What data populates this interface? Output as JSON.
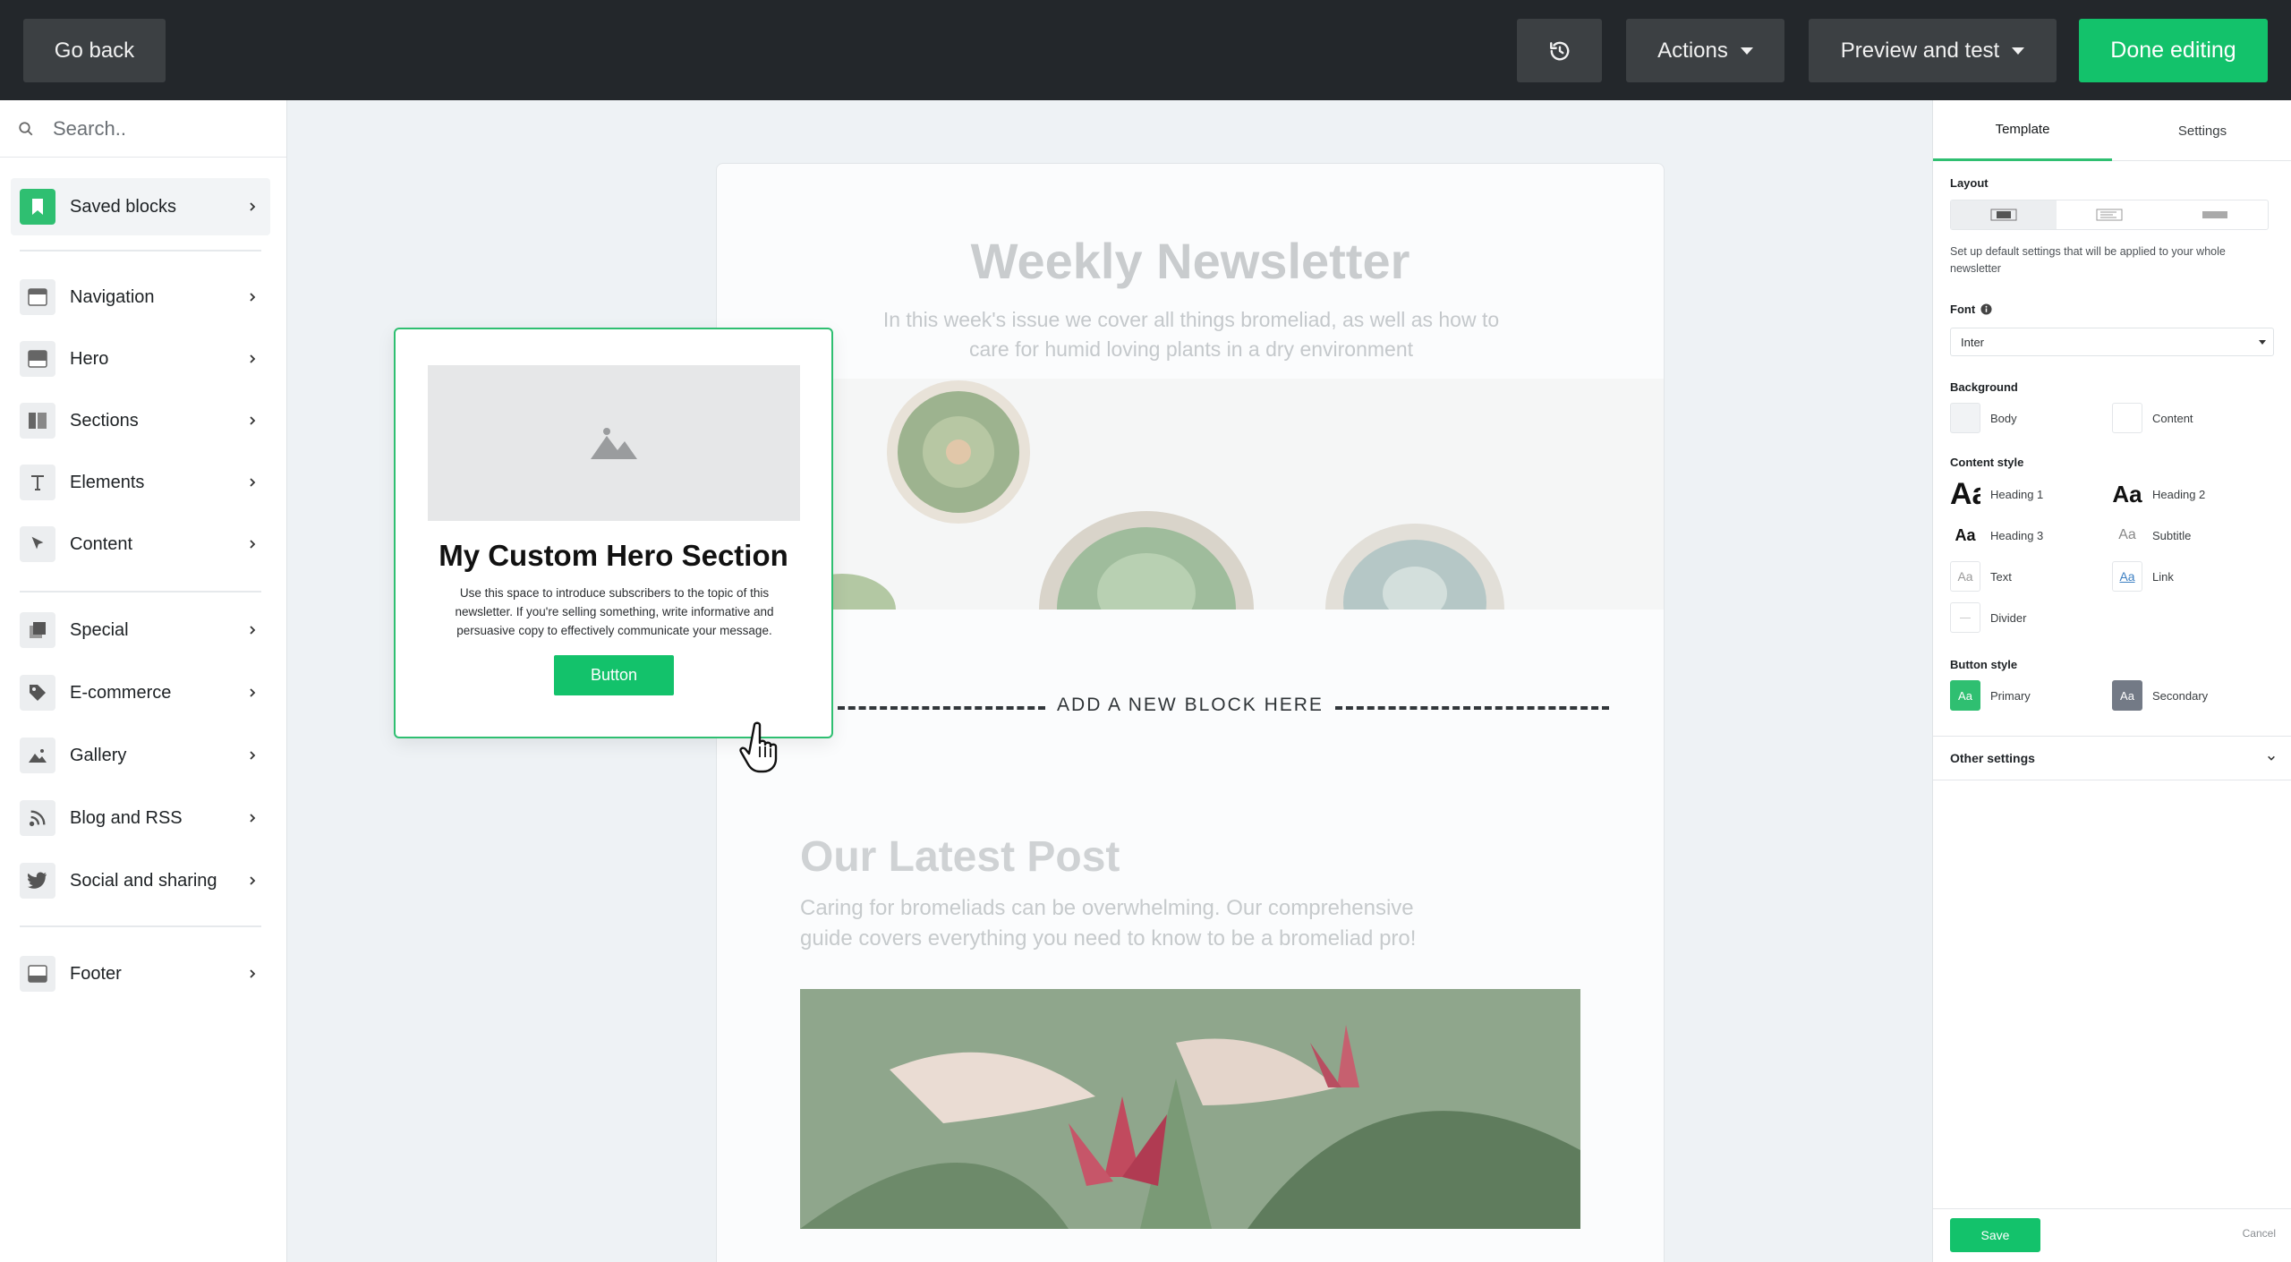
{
  "topbar": {
    "back_label": "Go back",
    "history_icon": "history-icon",
    "actions_label": "Actions",
    "preview_label": "Preview and test",
    "done_label": "Done editing"
  },
  "sidebar": {
    "search_placeholder": "Search..",
    "saved": {
      "label": "Saved blocks",
      "icon": "bookmark-icon"
    },
    "group1": [
      {
        "label": "Navigation",
        "icon": "navigation-icon"
      },
      {
        "label": "Hero",
        "icon": "hero-icon"
      },
      {
        "label": "Sections",
        "icon": "sections-icon"
      },
      {
        "label": "Elements",
        "icon": "text-icon"
      },
      {
        "label": "Content",
        "icon": "cursor-icon"
      }
    ],
    "group2": [
      {
        "label": "Special",
        "icon": "special-icon"
      },
      {
        "label": "E-commerce",
        "icon": "tag-icon"
      },
      {
        "label": "Gallery",
        "icon": "image-icon"
      },
      {
        "label": "Blog and RSS",
        "icon": "rss-icon"
      },
      {
        "label": "Social and sharing",
        "icon": "twitter-icon"
      }
    ],
    "footer_item": {
      "label": "Footer",
      "icon": "footer-icon"
    }
  },
  "canvas": {
    "newsletter_title": "Weekly Newsletter",
    "newsletter_subtitle": "In this week's issue we cover all things bromeliad, as well as how to care for humid loving plants in a dry environment",
    "drop_zone_label": "ADD A NEW BLOCK HERE",
    "post_title": "Our Latest Post",
    "post_text": "Caring for bromeliads can be overwhelming. Our comprehensive guide covers everything you need to know to be a bromeliad pro!"
  },
  "drag_card": {
    "title": "My Custom Hero Section",
    "text": "Use this space to introduce subscribers to the topic of this newsletter. If you're selling something, write informative and persuasive copy to effectively communicate your message.",
    "button_label": "Button"
  },
  "right_panel": {
    "tabs": [
      "Template",
      "Settings"
    ],
    "active_tab": "Template",
    "layout_label": "Layout",
    "layout_help": "Set up default settings that will be applied to your whole newsletter",
    "font_label": "Font",
    "font_value": "Inter",
    "background_label": "Background",
    "background_options": [
      "Body",
      "Content"
    ],
    "content_style_label": "Content style",
    "content_styles": {
      "heading1": "Heading 1",
      "heading2": "Heading 2",
      "heading3": "Heading 3",
      "subtitle": "Subtitle",
      "text": "Text",
      "link": "Link",
      "divider": "Divider"
    },
    "aa_glyph": "Aa",
    "button_style_label": "Button style",
    "button_styles": [
      "Primary",
      "Secondary"
    ],
    "other_settings_label": "Other settings",
    "save_label": "Save",
    "cancel_label": "Cancel"
  },
  "colors": {
    "accent": "#13c26b",
    "topbar": "#23272b",
    "secondary_button": "#737a86"
  }
}
